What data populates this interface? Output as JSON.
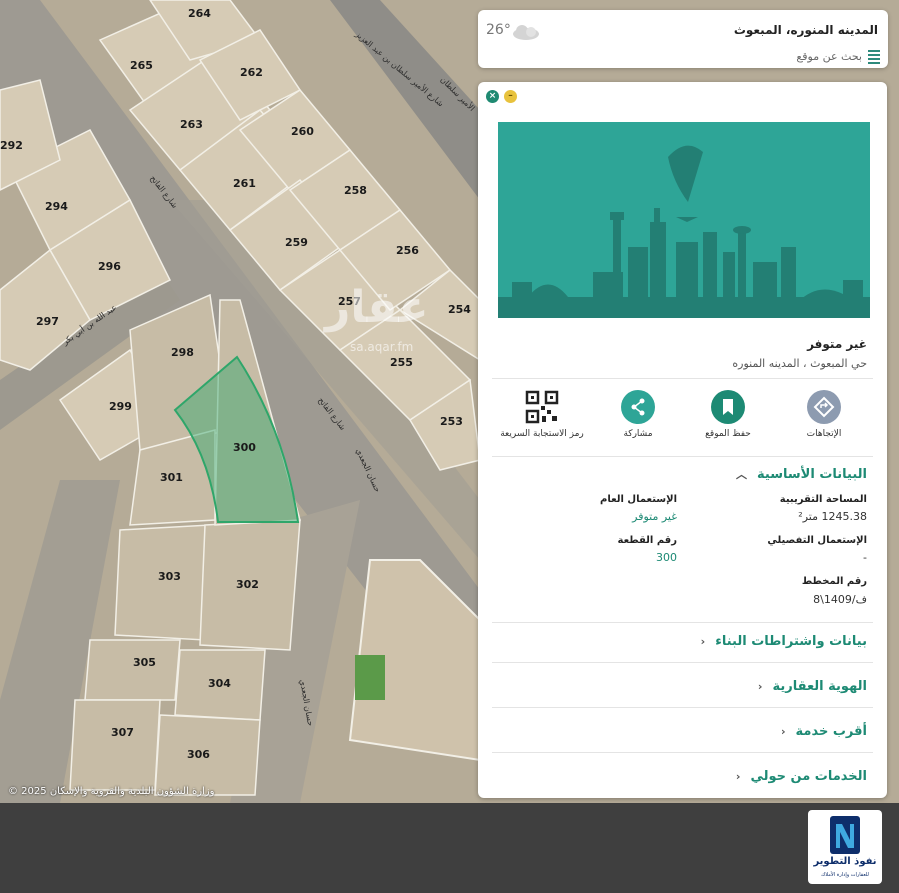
{
  "map": {
    "parcels": [
      "264",
      "265",
      "262",
      "263",
      "260",
      "261",
      "258",
      "259",
      "256",
      "257",
      "254",
      "255",
      "253",
      "294",
      "296",
      "297",
      "298",
      "299",
      "300",
      "301",
      "302",
      "303",
      "304",
      "305",
      "306",
      "307",
      "292"
    ],
    "streets": [
      "شارع الأمير سلطان بن عبد العزيز",
      "شارع الفاتح",
      "شارع الفاتح",
      "عبد الله بن أبي بكر",
      "حسان الجعدي",
      "حسان الجعدي",
      "الأمير سلطان"
    ],
    "attribution": "© 2025 وزارة الشؤون البلدية والقروية والإسكان",
    "watermark": "عقار",
    "watermark_sub": "sa.aqar.fm"
  },
  "search": {
    "title": "المدينه المنوره، المبعوث",
    "subtitle": "بحث عن موقع",
    "temperature": "26°",
    "list_icon": "list-icon",
    "weather_icon": "cloud-icon"
  },
  "panel": {
    "close_icon": "close-icon",
    "minimize_icon": "minimize-icon",
    "availability": "غير متوفر",
    "location": "حي المبعوث ، المدينه المنوره",
    "actions": [
      {
        "label": "الإتجاهات",
        "icon": "directions-icon",
        "color": "#8d9bb0"
      },
      {
        "label": "حفظ الموقع",
        "icon": "bookmark-icon",
        "color": "#1d8a74"
      },
      {
        "label": "مشاركة",
        "icon": "share-icon",
        "color": "#2ea597"
      },
      {
        "label": "رمز الاستجابة السريعة",
        "icon": "qr-code-icon",
        "color": "#222222"
      }
    ],
    "basic_info": {
      "title": "البيانات الأساسية",
      "area_label": "المساحة التقريبية",
      "area_value": "1245.38 متر²",
      "general_use_label": "الإستعمال العام",
      "general_use_value": "غير متوفر",
      "detailed_use_label": "الإستعمال التفصيلي",
      "detailed_use_value": "-",
      "plot_number_label": "رقم القطعة",
      "plot_number_value": "300",
      "plan_number_label": "رقم المخطط",
      "plan_number_value": "ف/1409\\8"
    },
    "sections": [
      {
        "label": "بيانات واشتراطات البناء"
      },
      {
        "label": "الهوية العقارية"
      },
      {
        "label": "أقرب خدمة"
      },
      {
        "label": "الخدمات من حولي"
      }
    ]
  },
  "footer": {
    "logo_name": "نفوذ التطوير",
    "logo_tagline": "للعقارات وإدارة الأملاك"
  },
  "colors": {
    "accent": "#1d8a74",
    "hero": "#2ea597",
    "selected_parcel": "#2fa66a"
  }
}
